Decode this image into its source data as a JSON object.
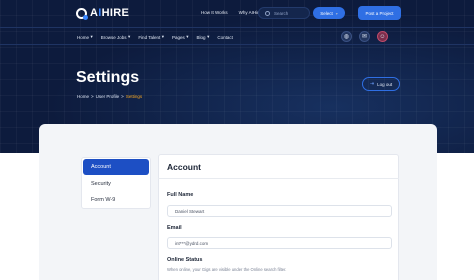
{
  "brand": {
    "name_prefix": "A",
    "name_accent": "I",
    "name_suffix": "HIRE"
  },
  "top_links": [
    "How It Works",
    "Why AIHire"
  ],
  "search": {
    "placeholder": "Search"
  },
  "select_button": {
    "label": "Select",
    "icon": "chevron-down-icon"
  },
  "post_button": {
    "label": "Post a Project"
  },
  "nav": {
    "items": [
      {
        "label": "Home",
        "has_caret": true
      },
      {
        "label": "Browse Jobs",
        "has_caret": true
      },
      {
        "label": "Find Talent",
        "has_caret": true
      },
      {
        "label": "Pages",
        "has_caret": true
      },
      {
        "label": "Blog",
        "has_caret": true
      },
      {
        "label": "Contact",
        "has_caret": false
      }
    ],
    "icons": [
      "globe-icon",
      "message-icon",
      "avatar"
    ]
  },
  "page": {
    "title": "Settings",
    "breadcrumb": {
      "home": "Home",
      "sep": ">",
      "parent": "User Profile",
      "current": "Settings"
    }
  },
  "logout": {
    "label": "Log out",
    "icon": "logout-icon"
  },
  "sidebar": {
    "items": [
      {
        "label": "Account",
        "active": true
      },
      {
        "label": "Security",
        "active": false
      },
      {
        "label": "Form W-9",
        "active": false
      }
    ]
  },
  "account": {
    "title": "Account",
    "full_name_label": "Full Name",
    "full_name_value": "Daniel Stewart",
    "email_label": "Email",
    "email_value": "int***@ydrd.com",
    "online_status_label": "Online Status",
    "online_status_hint": "When online, your Gigs are visible under the Online search filter."
  },
  "colors": {
    "hero_bg": "#0d1b3d",
    "accent": "#2f6fe4",
    "active_tab": "#1d4fc4",
    "breadcrumb_current": "#f5a623"
  }
}
